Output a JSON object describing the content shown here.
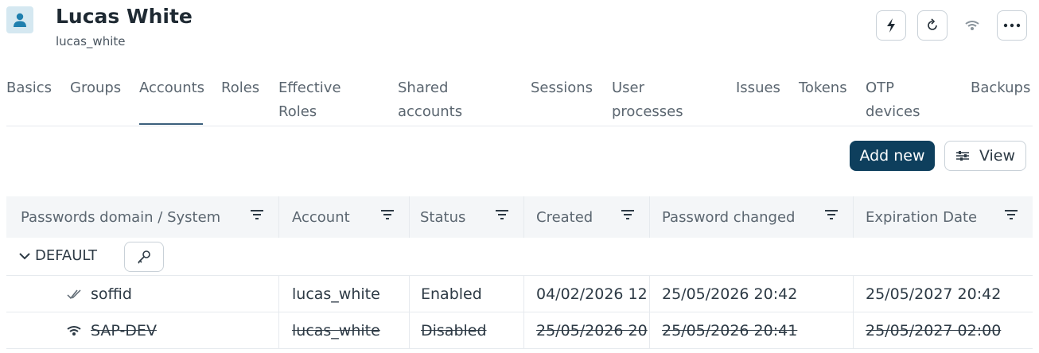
{
  "header": {
    "name": "Lucas White",
    "login": "lucas_white",
    "icons": [
      "lightning-icon",
      "refresh-icon",
      "wifi-icon",
      "more-icon"
    ]
  },
  "tabs": [
    {
      "label": "Basics"
    },
    {
      "label": "Groups"
    },
    {
      "label": "Accounts",
      "active": true
    },
    {
      "label": "Roles"
    },
    {
      "label": "Effective Roles"
    },
    {
      "label": "Shared accounts"
    },
    {
      "label": "Sessions"
    },
    {
      "label": "User processes"
    },
    {
      "label": "Issues"
    },
    {
      "label": "Tokens"
    },
    {
      "label": "OTP devices"
    },
    {
      "label": "Backups"
    }
  ],
  "actions": {
    "add_new": "Add new",
    "view": "View"
  },
  "table": {
    "columns": [
      "Passwords domain / System",
      "Account",
      "Status",
      "Created",
      "Password changed",
      "Expiration Date"
    ],
    "group": "DEFAULT",
    "rows": [
      {
        "system": "soffid",
        "icon": "checkmark-icon",
        "account": "lucas_white",
        "status": "Enabled",
        "created": "04/02/2026 12",
        "password_changed": "25/05/2026 20:42",
        "expiration": "25/05/2027 20:42",
        "disabled": false
      },
      {
        "system": "SAP-DEV",
        "icon": "wifi-icon",
        "account": "lucas_white",
        "status": "Disabled",
        "created": "25/05/2026 20",
        "password_changed": "25/05/2026 20:41",
        "expiration": "25/05/2027 02:00",
        "disabled": true
      }
    ]
  },
  "colors": {
    "primary": "#0e3f5d",
    "avatar_bg": "#d5e8f1",
    "avatar_icon": "#1f7fae",
    "header_bg": "#f4f6f8"
  }
}
